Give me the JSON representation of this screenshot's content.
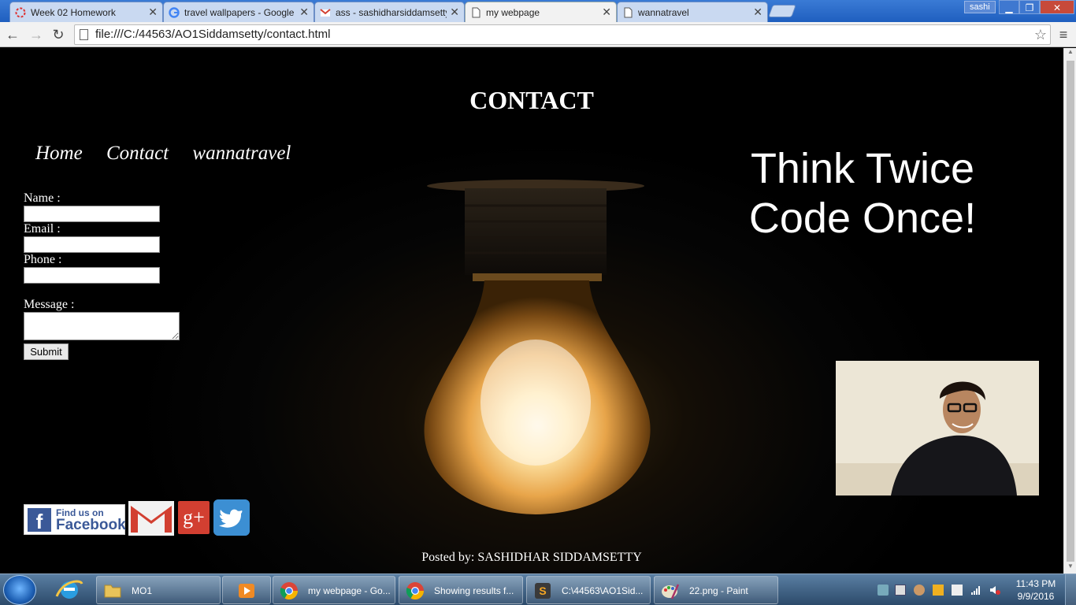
{
  "browser": {
    "tabs": [
      {
        "label": "Week 02 Homework",
        "icon": "loading-icon",
        "active": false
      },
      {
        "label": "travel wallpapers - Google",
        "icon": "google-icon",
        "active": false
      },
      {
        "label": "ass - sashidharsiddamsetty",
        "icon": "gmail-icon",
        "active": false
      },
      {
        "label": "my webpage",
        "icon": "page-icon",
        "active": true
      },
      {
        "label": "wannatravel",
        "icon": "page-icon",
        "active": false
      }
    ],
    "user": "sashi",
    "url": "file:///C:/44563/AO1Siddamsetty/contact.html"
  },
  "page": {
    "title": "CONTACT",
    "nav": [
      "Home",
      "Contact",
      "wannatravel"
    ],
    "slogan_line1": "Think Twice",
    "slogan_line2": "Code Once!",
    "form": {
      "name_label": "Name :",
      "email_label": "Email :",
      "phone_label": "Phone :",
      "message_label": "Message :",
      "name_value": "",
      "email_value": "",
      "phone_value": "",
      "message_value": "",
      "submit_label": "Submit"
    },
    "social": {
      "facebook_line1": "Find us on",
      "facebook_line2": "Facebook",
      "googleplus_label": "g+"
    },
    "footer": "Posted by: SASHIDHAR SIDDAMSETTY"
  },
  "taskbar": {
    "items": [
      {
        "label": "MO1",
        "icon": "folder-icon"
      },
      {
        "label": "",
        "icon": "media-player-icon"
      },
      {
        "label": "my webpage - Go...",
        "icon": "chrome-icon"
      },
      {
        "label": "Showing results f...",
        "icon": "chrome-icon"
      },
      {
        "label": "C:\\44563\\AO1Sid...",
        "icon": "sublime-icon"
      },
      {
        "label": "22.png - Paint",
        "icon": "paint-icon"
      }
    ],
    "time": "11:43 PM",
    "date": "9/9/2016"
  },
  "colors": {
    "chrome_blue": "#2d6ac9",
    "page_background": "#000000",
    "facebook_blue": "#3b5998",
    "googleplus_red": "#d23f31",
    "twitter_blue": "#3c8fd3"
  }
}
